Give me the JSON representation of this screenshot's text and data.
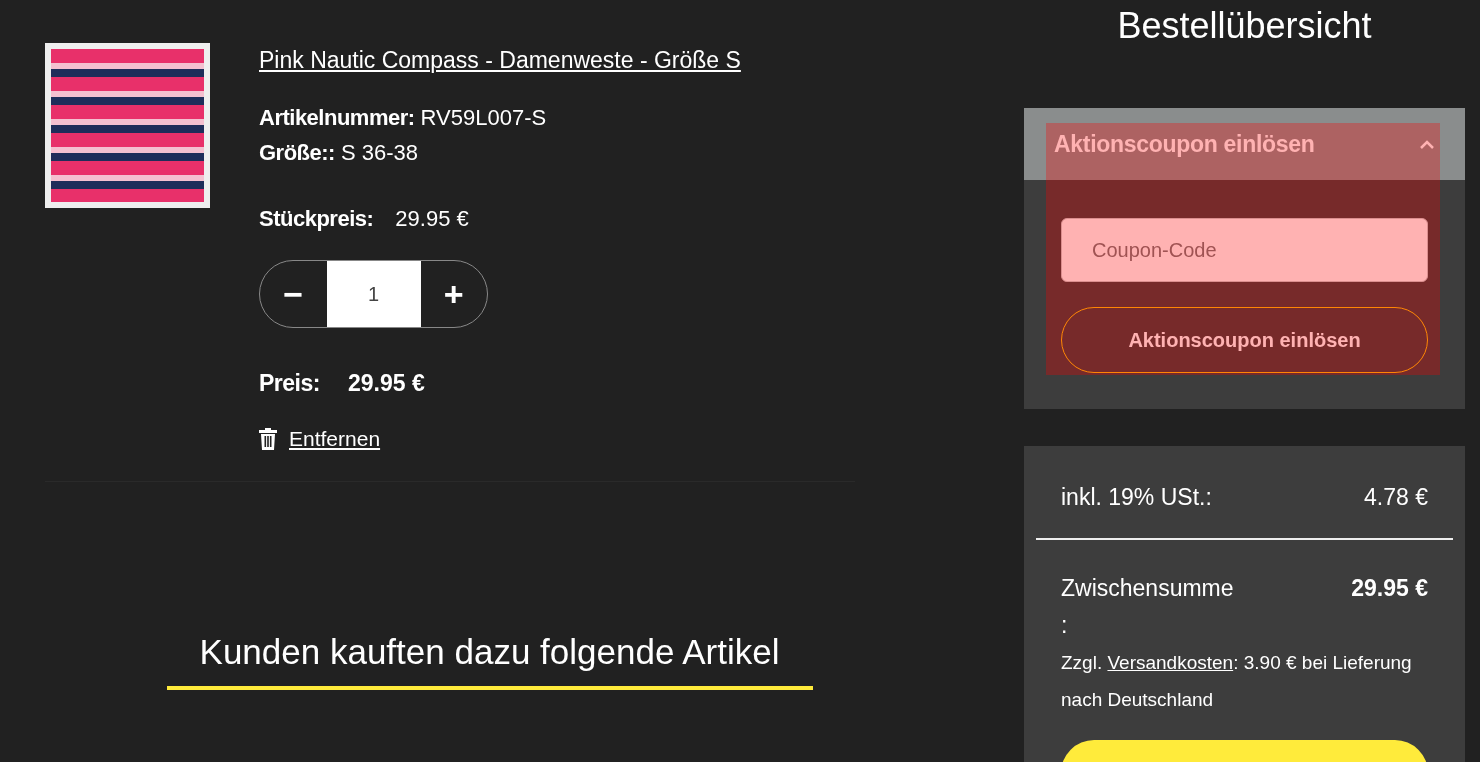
{
  "product": {
    "title": "Pink Nautic Compass - Damenweste - Größe S",
    "attributes": [
      {
        "label": "Artikelnummer:",
        "value": "RV59L007-S"
      },
      {
        "label": "Größe::",
        "value": "S 36-38"
      }
    ],
    "unit_price": {
      "label": "Stückpreis:",
      "value": "29.95 €"
    },
    "quantity": {
      "minus": "−",
      "value": "1",
      "plus": "+"
    },
    "price": {
      "label": "Preis:",
      "value": "29.95 €"
    },
    "remove_link": "Entfernen"
  },
  "recommendations": {
    "heading": "Kunden kauften dazu folgende Artikel"
  },
  "summary": {
    "title": "Bestellübersicht",
    "coupon": {
      "header": "Aktionscoupon einlösen",
      "expanded": true,
      "placeholder": "Coupon-Code",
      "button": "Aktionscoupon einlösen"
    },
    "tax": {
      "label": "inkl. 19% USt.:",
      "value": "4.78 €"
    },
    "subtotal": {
      "label": "Zwischensumme\n:",
      "value": "29.95 €"
    },
    "shipping": {
      "prefix": "Zzgl. ",
      "link": "Versandkosten",
      "suffix": ": 3.90 € bei Lieferung nach Deutschland"
    }
  }
}
